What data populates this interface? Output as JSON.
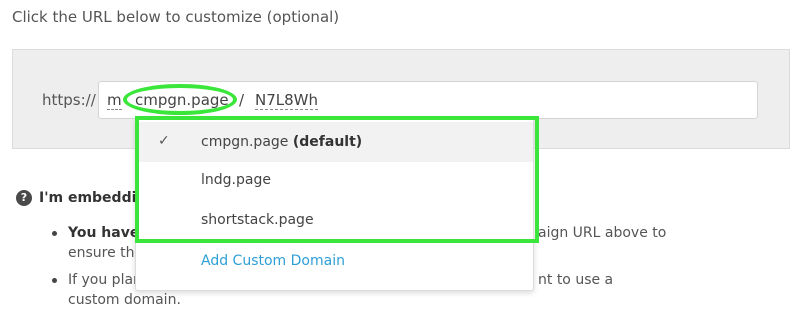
{
  "instruction": "Click the URL below to customize (optional)",
  "url": {
    "prefix": "https://",
    "subdomain": "m",
    "domain": "cmpgn.page",
    "separator": "/",
    "slug": "N7L8Wh"
  },
  "dropdown": {
    "options": [
      {
        "label": "cmpgn.page",
        "suffix": "(default)",
        "selected": true,
        "check": "✓"
      },
      {
        "label": "lndg.page",
        "selected": false
      },
      {
        "label": "shortstack.page",
        "selected": false
      }
    ],
    "add_custom_domain": "Add Custom Domain"
  },
  "faq": {
    "icon": "?",
    "title": "I'm embeddin"
  },
  "bullets": [
    {
      "lead": "You have",
      "lead_cont": "ensure tha",
      "tail": "aign URL above to"
    },
    {
      "lead": "If you plan",
      "lead_cont": "custom domain.",
      "tail": "nt to use a"
    }
  ],
  "colors": {
    "highlight": "#39e639",
    "link": "#2e9fd6",
    "panel_bg": "#eeeeee"
  }
}
